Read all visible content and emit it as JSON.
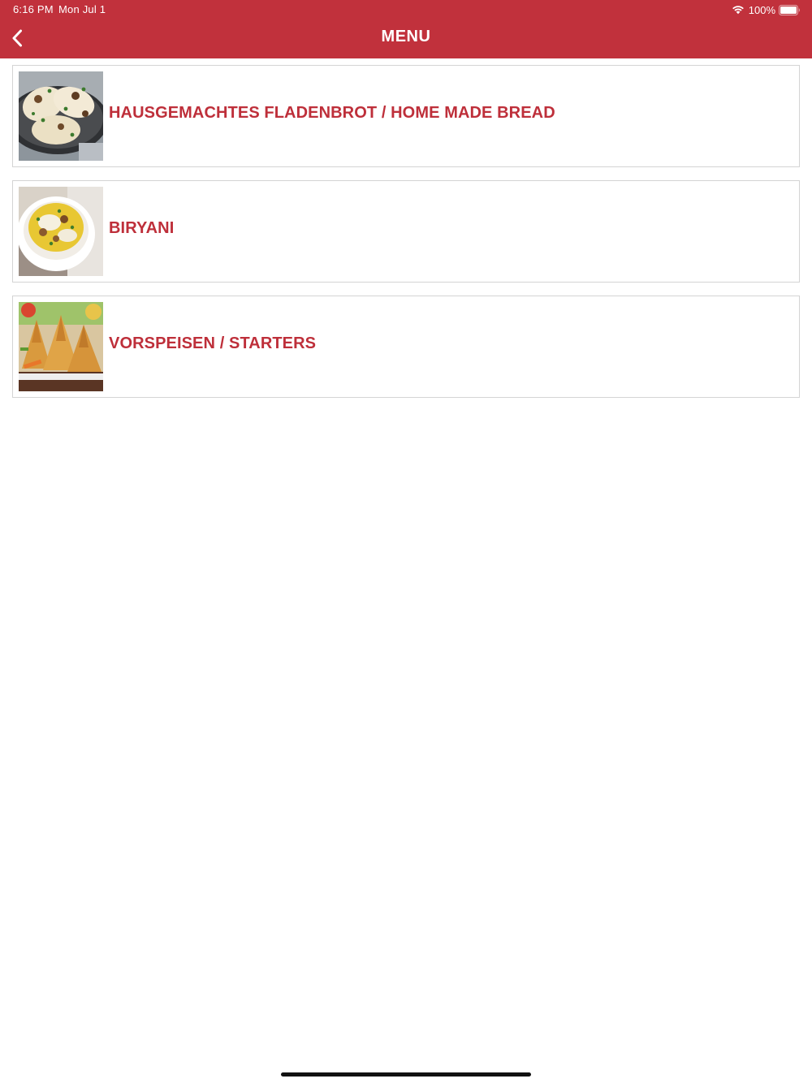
{
  "status_bar": {
    "time": "6:16 PM",
    "date": "Mon Jul 1",
    "battery": "100%"
  },
  "header": {
    "title": "MENU",
    "back_icon": "chevron-left-icon"
  },
  "menu": {
    "items": [
      {
        "label": "HAUSGEMACHTES FLADENBROT / HOME MADE BREAD",
        "image": "naan-bread-photo"
      },
      {
        "label": "BIRYANI",
        "image": "biryani-bowl-photo"
      },
      {
        "label": "VORSPEISEN / STARTERS",
        "image": "samosa-starters-photo"
      }
    ]
  },
  "colors": {
    "brand": "#c1313c",
    "label": "#be2f3a",
    "border": "#d4d4d4",
    "background": "#ffffff"
  }
}
